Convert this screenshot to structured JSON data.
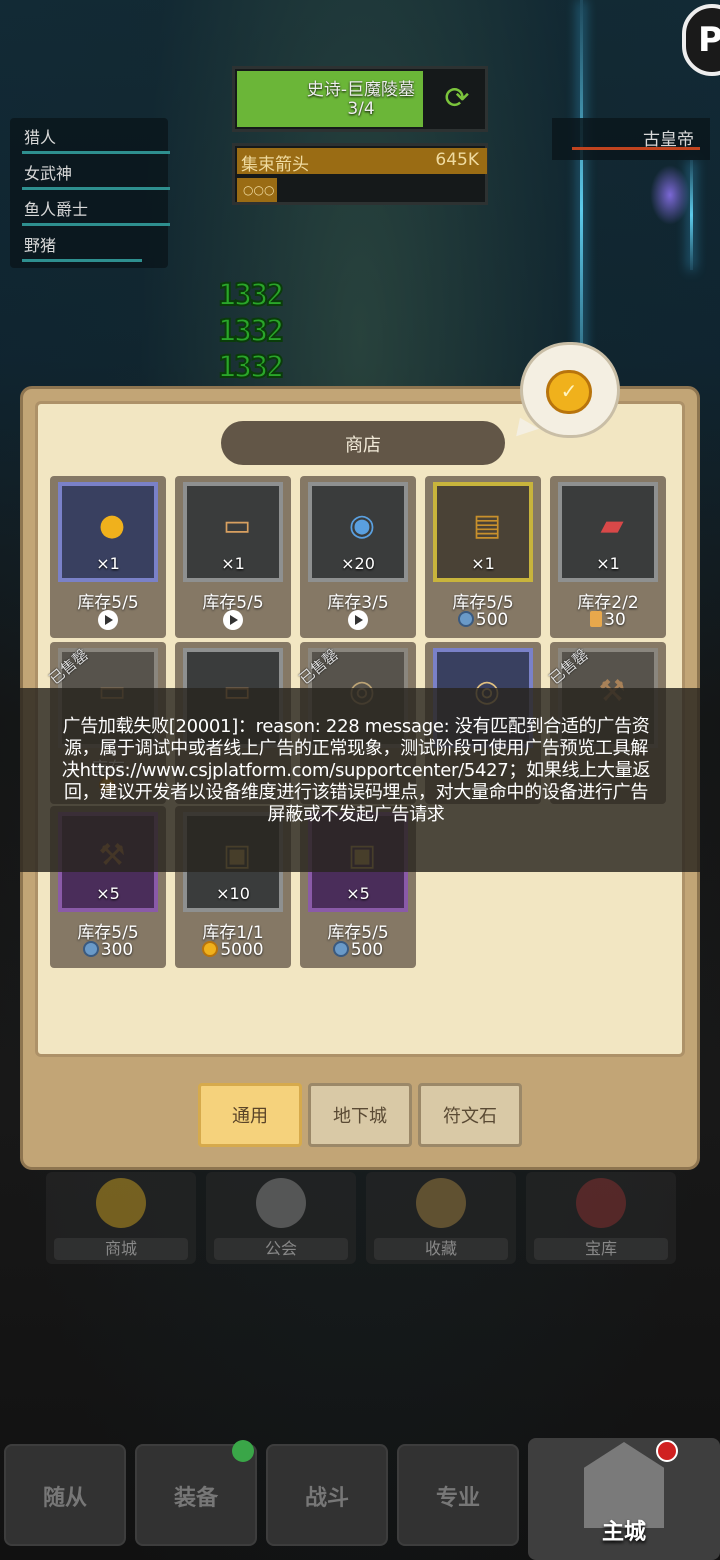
{
  "corner_button": {
    "label": "P"
  },
  "enemies": [
    {
      "name": "猎人"
    },
    {
      "name": "女武神"
    },
    {
      "name": "鱼人爵士"
    },
    {
      "name": "野猪"
    }
  ],
  "boss": {
    "name": "古皇帝"
  },
  "stage": {
    "title": "史诗-巨魔陵墓",
    "progress": "3/4"
  },
  "skill": {
    "name": "集束箭头",
    "value": "645K",
    "sub": "○○○"
  },
  "damage_numbers": [
    "1332",
    "1332",
    "1332"
  ],
  "shop": {
    "title": "商店",
    "items": [
      {
        "qty": "×1",
        "stock": "库存5/5",
        "price_type": "ad",
        "price": "",
        "sold": false,
        "icon": "coins-icon",
        "rarity": "rare"
      },
      {
        "qty": "×1",
        "stock": "库存5/5",
        "price_type": "ad",
        "price": "",
        "sold": false,
        "icon": "scroll-icon",
        "rarity": "common"
      },
      {
        "qty": "×20",
        "stock": "库存3/5",
        "price_type": "ad",
        "price": "",
        "sold": false,
        "icon": "gem-icon",
        "rarity": "common"
      },
      {
        "qty": "×1",
        "stock": "库存5/5",
        "price_type": "gem",
        "price": "500",
        "sold": false,
        "icon": "treasure-chest-icon",
        "rarity": "gold"
      },
      {
        "qty": "×1",
        "stock": "库存2/2",
        "price_type": "scroll",
        "price": "30",
        "sold": false,
        "icon": "red-scroll-icon",
        "rarity": "common"
      },
      {
        "qty": "",
        "stock": "库存",
        "price_type": "coin",
        "price": "",
        "sold": true,
        "sold_label": "已售罄",
        "icon": "scroll-icon",
        "rarity": "common"
      },
      {
        "qty": "",
        "stock": "",
        "price_type": "none",
        "price": "",
        "sold": false,
        "icon": "scroll-icon",
        "rarity": "common"
      },
      {
        "qty": "",
        "stock": "",
        "price_type": "none",
        "price": "",
        "sold": true,
        "sold_label": "已售罄",
        "icon": "rope-icon",
        "rarity": "common"
      },
      {
        "qty": "",
        "stock": "",
        "price_type": "none",
        "price": "",
        "sold": false,
        "icon": "rope-icon",
        "rarity": "rare"
      },
      {
        "qty": "",
        "stock": "",
        "price_type": "none",
        "price": "",
        "sold": true,
        "sold_label": "已售罄",
        "icon": "pickaxe-icon",
        "rarity": "common"
      },
      {
        "qty": "×5",
        "stock": "库存5/5",
        "price_type": "gem",
        "price": "300",
        "sold": false,
        "icon": "pickaxe-icon",
        "rarity": "epic"
      },
      {
        "qty": "×10",
        "stock": "库存1/1",
        "price_type": "coin",
        "price": "5000",
        "sold": false,
        "icon": "rune-tablet-icon",
        "rarity": "common"
      },
      {
        "qty": "×5",
        "stock": "库存5/5",
        "price_type": "gem",
        "price": "500",
        "sold": false,
        "icon": "rune-tablet-icon",
        "rarity": "epic"
      }
    ],
    "tabs": [
      {
        "label": "通用",
        "active": true
      },
      {
        "label": "地下城",
        "active": false
      },
      {
        "label": "符文石",
        "active": false
      }
    ]
  },
  "ad_error": {
    "message": "广告加载失败[20001]：reason: 228  message: 没有匹配到合适的广告资源，属于调试中或者线上广告的正常现象，测试阶段可使用广告预览工具解决https://www.csjplatform.com/supportcenter/5427；如果线上大量返回，建议开发者以设备维度进行该错误码埋点，对大量命中的设备进行广告屏蔽或不发起广告请求"
  },
  "buildings": [
    {
      "label": "商城"
    },
    {
      "label": "公会"
    },
    {
      "label": "收藏"
    },
    {
      "label": "宝库"
    }
  ],
  "bottom_nav": [
    {
      "label": "随从"
    },
    {
      "label": "装备"
    },
    {
      "label": "战斗"
    },
    {
      "label": "专业"
    },
    {
      "label": "主城"
    }
  ],
  "colors": {
    "stage_fill": "#6bb638",
    "skill_fill": "#9a6c14",
    "panel_bg": "#c2a576",
    "tab_active": "#f5d27c",
    "damage_text": "#2aa62a"
  }
}
